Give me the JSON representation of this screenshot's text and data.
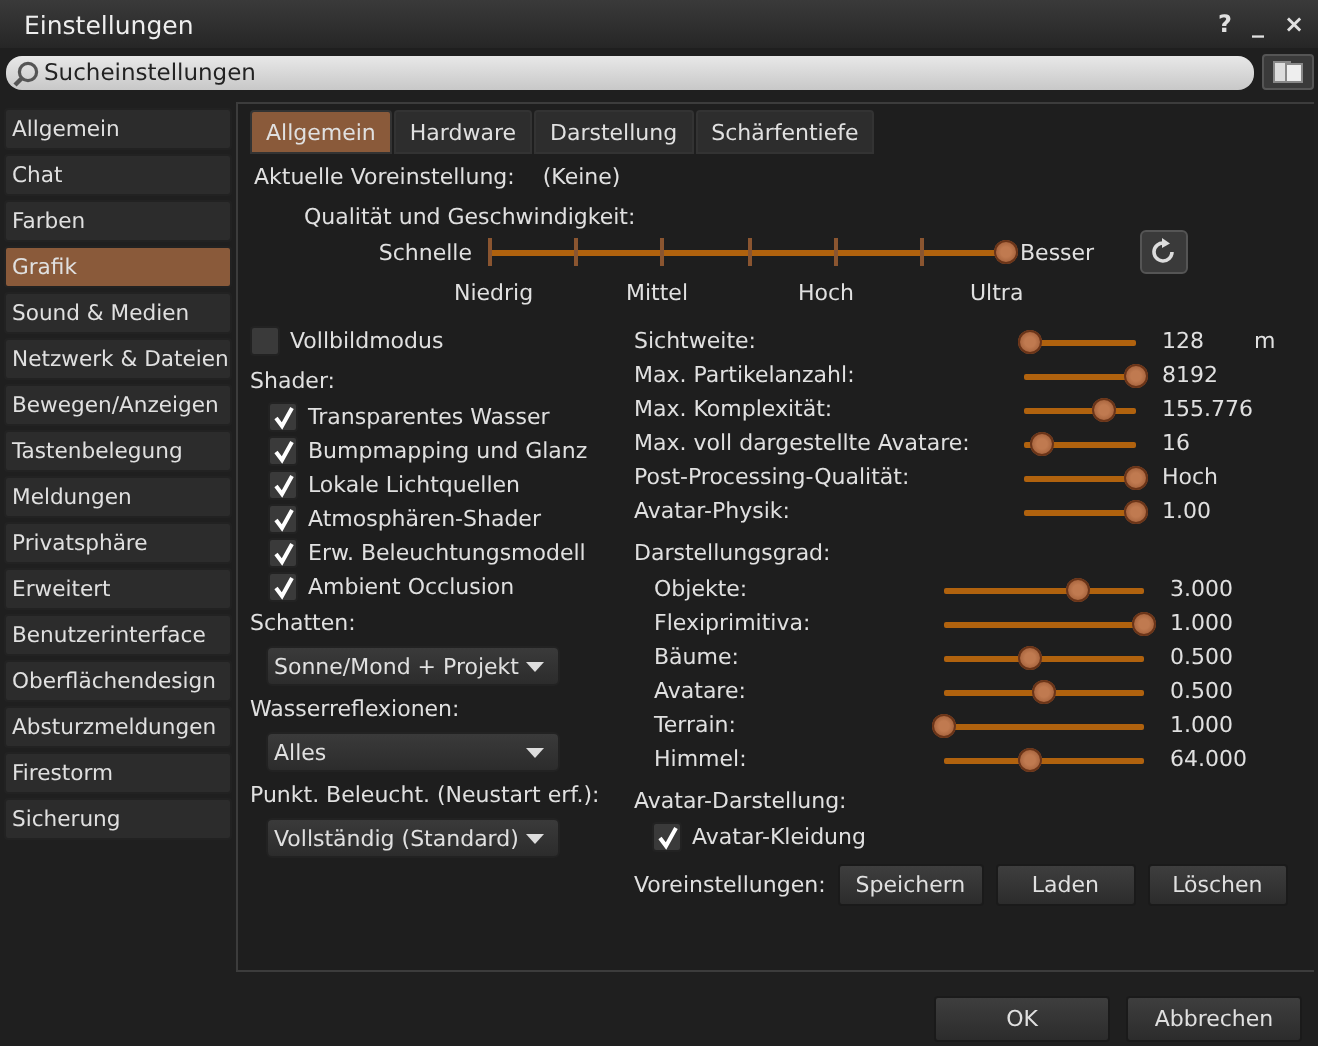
{
  "window": {
    "title": "Einstellungen",
    "controls": [
      "?",
      "_",
      "×"
    ]
  },
  "search": {
    "placeholder": "Sucheinstellungen"
  },
  "sidebar": {
    "items": [
      {
        "label": "Allgemein",
        "selected": false
      },
      {
        "label": "Chat",
        "selected": false
      },
      {
        "label": "Farben",
        "selected": false
      },
      {
        "label": "Grafik",
        "selected": true
      },
      {
        "label": "Sound & Medien",
        "selected": false
      },
      {
        "label": "Netzwerk & Dateien",
        "selected": false
      },
      {
        "label": "Bewegen/Anzeigen",
        "selected": false
      },
      {
        "label": "Tastenbelegung",
        "selected": false
      },
      {
        "label": "Meldungen",
        "selected": false
      },
      {
        "label": "Privatsphäre",
        "selected": false
      },
      {
        "label": "Erweitert",
        "selected": false
      },
      {
        "label": "Benutzerinterface",
        "selected": false
      },
      {
        "label": "Oberflächendesign",
        "selected": false
      },
      {
        "label": "Absturzmeldungen",
        "selected": false
      },
      {
        "label": "Firestorm",
        "selected": false
      },
      {
        "label": "Sicherung",
        "selected": false
      }
    ]
  },
  "tabs": [
    {
      "label": "Allgemein",
      "selected": true
    },
    {
      "label": "Hardware",
      "selected": false
    },
    {
      "label": "Darstellung",
      "selected": false
    },
    {
      "label": "Schärfentiefe",
      "selected": false
    }
  ],
  "preset": {
    "label": "Aktuelle Voreinstellung:",
    "value": "(Keine)"
  },
  "quality": {
    "label": "Qualität und Geschwindigkeit:",
    "low_label": "Schnelle",
    "high_label": "Besser",
    "level": 1,
    "steps": [
      "Niedrig",
      "Mittel",
      "Hoch",
      "Ultra"
    ]
  },
  "fullscreen": {
    "label": "Vollbildmodus",
    "checked": false
  },
  "shader": {
    "label": "Shader:",
    "options": [
      {
        "label": "Transparentes Wasser",
        "checked": true
      },
      {
        "label": "Bumpmapping und Glanz",
        "checked": true
      },
      {
        "label": "Lokale Lichtquellen",
        "checked": true
      },
      {
        "label": "Atmosphären-Shader",
        "checked": true
      },
      {
        "label": "Erw. Beleuchtungsmodell",
        "checked": true
      },
      {
        "label": "Ambient Occlusion",
        "checked": true
      }
    ]
  },
  "dropdowns": [
    {
      "label": "Schatten:",
      "value": "Sonne/Mond + Projekt"
    },
    {
      "label": "Wasserreflexionen:",
      "value": "Alles"
    },
    {
      "label": "Punkt. Beleucht. (Neustart erf.):",
      "value": "Vollständig (Standard)"
    }
  ],
  "settings": [
    {
      "label": "Sichtweite:",
      "level": 0.05,
      "reading": "128",
      "unit": "m"
    },
    {
      "label": "Max. Partikelanzahl:",
      "level": 1,
      "reading": "8192"
    },
    {
      "label": "Max. Komplexität:",
      "level": 0.72,
      "reading": "155.776"
    },
    {
      "label": "Max. voll dargestellte Avatare:",
      "level": 0.16,
      "reading": "16"
    },
    {
      "label": "Post-Processing-Qualität:",
      "level": 1,
      "reading": "Hoch"
    },
    {
      "label": "Avatar-Physik:",
      "level": 1,
      "reading": "1.00"
    }
  ],
  "detail": {
    "label": "Darstellungsgrad:",
    "sliders": [
      {
        "label": "Objekte:",
        "level": 0.67,
        "reading": "3.000"
      },
      {
        "label": "Flexiprimitiva:",
        "level": 1,
        "reading": "1.000"
      },
      {
        "label": "Bäume:",
        "level": 0.43,
        "reading": "0.500"
      },
      {
        "label": "Avatare:",
        "level": 0.5,
        "reading": "0.500"
      },
      {
        "label": "Terrain:",
        "level": 0,
        "reading": "1.000"
      },
      {
        "label": "Himmel:",
        "level": 0.43,
        "reading": "64.000"
      }
    ]
  },
  "avatar_display": {
    "label": "Avatar-Darstellung:",
    "option": {
      "label": "Avatar-Kleidung",
      "checked": true
    }
  },
  "presets": {
    "label": "Voreinstellungen:",
    "buttons": [
      "Speichern",
      "Laden",
      "Löschen"
    ]
  },
  "footer": {
    "buttons": [
      "OK",
      "Abbrechen"
    ]
  }
}
